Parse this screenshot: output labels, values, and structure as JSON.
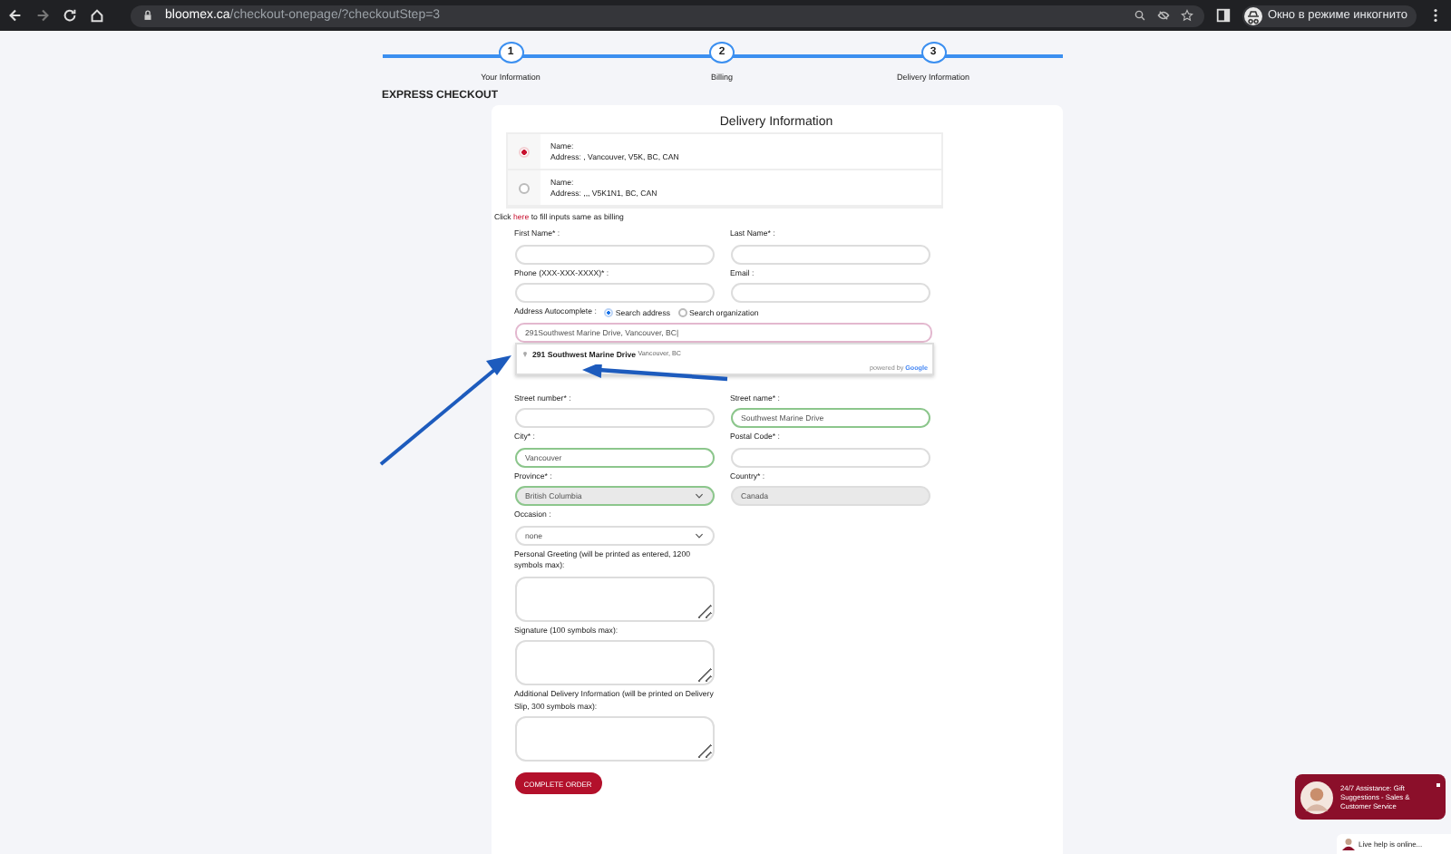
{
  "browser": {
    "url_domain": "bloomex.ca",
    "url_path": "/checkout-onepage/?checkoutStep=3",
    "profile_label": "Окно в режиме инкогнито"
  },
  "steps": [
    {
      "number": "1",
      "label": "Your Information"
    },
    {
      "number": "2",
      "label": "Billing"
    },
    {
      "number": "3",
      "label": "Delivery Information"
    }
  ],
  "heading": "EXPRESS CHECKOUT",
  "delivery": {
    "title": "Delivery Information",
    "saved_addresses": [
      {
        "name": "Name:",
        "address": "Address: , Vancouver, V5K, BC, CAN",
        "selected": true
      },
      {
        "name": "Name:",
        "address": "Address: ,,, V5K1N1, BC, CAN",
        "selected": false
      }
    ],
    "billing_note": {
      "before": "Click",
      "link": "here",
      "after": "to fill inputs same as billing"
    },
    "rows": [
      [
        {
          "kind": "text",
          "label": "First Name* :",
          "valid": false
        },
        {
          "kind": "text",
          "label": "Last Name* :",
          "valid": false
        }
      ],
      [
        {
          "kind": "text",
          "label": "Phone (XXX-XXX-XXXX)* :",
          "valid": false
        },
        {
          "kind": "text",
          "label": "Email :",
          "valid": false
        }
      ],
      [
        {
          "kind": "autocomplete",
          "label": "Address Autocomplete :",
          "options": [
            {
              "label": "Search address",
              "selected": true
            },
            {
              "label": "Search organization",
              "selected": false
            }
          ],
          "value": "291Southwest Marine Drive, Vancouver, BC|",
          "suggestion": {
            "main": "291 Southwest Marine Drive",
            "secondary": "Vancouver, BC"
          },
          "powered_by": "powered by",
          "brand": "Google"
        }
      ],
      [
        {
          "kind": "text",
          "label": "Street number* :",
          "valid": false
        },
        {
          "kind": "text",
          "label": "Street name* :",
          "value": "Southwest Marine Drive",
          "valid": true
        }
      ],
      [
        {
          "kind": "text",
          "label": "City* :",
          "value": "Vancouver",
          "valid": true
        },
        {
          "kind": "text",
          "label": "Postal Code* :",
          "valid": false
        }
      ],
      [
        {
          "kind": "select",
          "label": "Province* :",
          "value": "British Columbia",
          "valid": true,
          "disabled": true
        },
        {
          "kind": "readonly",
          "label": "Country* :",
          "value": "Canada"
        }
      ],
      [
        {
          "kind": "select",
          "label": "Occasion :",
          "value": "none",
          "valid": false,
          "disabled": false
        }
      ],
      [
        {
          "kind": "textarea",
          "label": "Personal Greeting (will be printed as entered, 1200 symbols max):"
        }
      ],
      [
        {
          "kind": "textarea",
          "label": "Signature (100 symbols max):"
        }
      ],
      [
        {
          "kind": "textarea",
          "label": "Additional Delivery Information (will be printed on Delivery Slip, 300 symbols max):"
        }
      ]
    ],
    "submit": "COMPLETE ORDER"
  },
  "chat": {
    "message": "24/7 Assistance: Gift Suggestions - Sales & Customer Service",
    "status": "Live help is online..."
  }
}
